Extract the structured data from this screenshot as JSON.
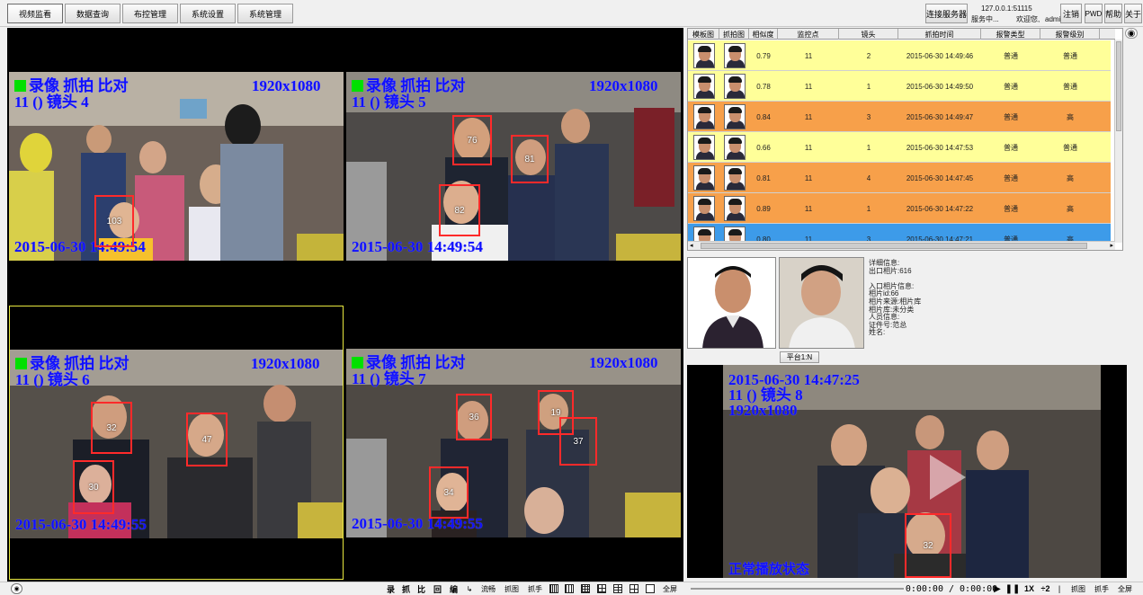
{
  "toolbar": {
    "tabs": [
      "视频监看",
      "数据查询",
      "布控管理",
      "系统设置",
      "系统管理"
    ],
    "connect_label": "连接服务器",
    "server_address": "127.0.0.1:51115",
    "server_status": "服务中...",
    "welcome": "欢迎您,",
    "username": "admi",
    "logout": "注销",
    "pwd": "PWD",
    "help": "帮助",
    "about": "关于"
  },
  "cameras": [
    {
      "overlay_status": "录像 抓拍 比对",
      "overlay_cam": "11 () 镜头 4",
      "resolution": "1920x1080",
      "timestamp": "2015-06-30 14:49:54",
      "faces": [
        "103",
        ""
      ]
    },
    {
      "overlay_status": "录像 抓拍 比对",
      "overlay_cam": "11 () 镜头 5",
      "resolution": "1920x1080",
      "timestamp": "2015-06-30 14:49:54",
      "faces": [
        "76",
        "81",
        "82"
      ]
    },
    {
      "overlay_status": "录像 抓拍 比对",
      "overlay_cam": "11 () 镜头 6",
      "resolution": "1920x1080",
      "timestamp": "2015-06-30 14:49:55",
      "faces": [
        "32",
        "47",
        "30"
      ]
    },
    {
      "overlay_status": "录像 抓拍 比对",
      "overlay_cam": "11 () 镜头 7",
      "resolution": "1920x1080",
      "timestamp": "2015-06-30 14:49:55",
      "faces": [
        "36",
        "19",
        "37",
        "34"
      ]
    }
  ],
  "alarm_table": {
    "headers": [
      "模板图",
      "抓拍图",
      "相似度",
      "监控点",
      "镜头",
      "抓拍时间",
      "报警类型",
      "报警级别"
    ],
    "rows": [
      {
        "similarity": "0.79",
        "point": "11",
        "lens": "2",
        "time": "2015-06-30 14:49:46",
        "type": "普通",
        "level": "普通",
        "color": "#ffff99"
      },
      {
        "similarity": "0.78",
        "point": "11",
        "lens": "1",
        "time": "2015-06-30 14:49:50",
        "type": "普通",
        "level": "普通",
        "color": "#ffff99"
      },
      {
        "similarity": "0.84",
        "point": "11",
        "lens": "3",
        "time": "2015-06-30 14:49:47",
        "type": "普通",
        "level": "高",
        "color": "#f7a04a"
      },
      {
        "similarity": "0.66",
        "point": "11",
        "lens": "1",
        "time": "2015-06-30 14:47:53",
        "type": "普通",
        "level": "普通",
        "color": "#ffff99"
      },
      {
        "similarity": "0.81",
        "point": "11",
        "lens": "4",
        "time": "2015-06-30 14:47:45",
        "type": "普通",
        "level": "高",
        "color": "#f7a04a"
      },
      {
        "similarity": "0.89",
        "point": "11",
        "lens": "1",
        "time": "2015-06-30 14:47:22",
        "type": "普通",
        "level": "高",
        "color": "#f7a04a"
      },
      {
        "similarity": "0.80",
        "point": "11",
        "lens": "3",
        "time": "2015-06-30 14:47:21",
        "type": "普通",
        "level": "高",
        "color": "#3d9be9"
      }
    ]
  },
  "detail": {
    "platform_button": "平台1:N",
    "lines": [
      "详细信息:",
      "出口相片:616",
      "",
      "入口相片信息:",
      "相片id:66",
      "相片来源:相片库",
      "相片库:未分类",
      "人员信息:",
      "证件号:范总",
      "姓名:"
    ]
  },
  "playback": {
    "timestamp": "2015-06-30 14:47:25",
    "cam": "11 () 镜头 8",
    "resolution": "1920x1080",
    "status": "正常播放状态",
    "face": "32"
  },
  "bottom": {
    "left_controls": [
      "录",
      "抓",
      "比",
      "回",
      "编"
    ],
    "stream_label": "流畅",
    "snap_label": "抓图",
    "grab_label": "抓手",
    "fullscreen": "全屏",
    "time_display": "0:00:00 / 0:00:00",
    "right_controls": [
      "1X",
      "÷2",
      "抓图",
      "抓手",
      "全屏"
    ]
  }
}
